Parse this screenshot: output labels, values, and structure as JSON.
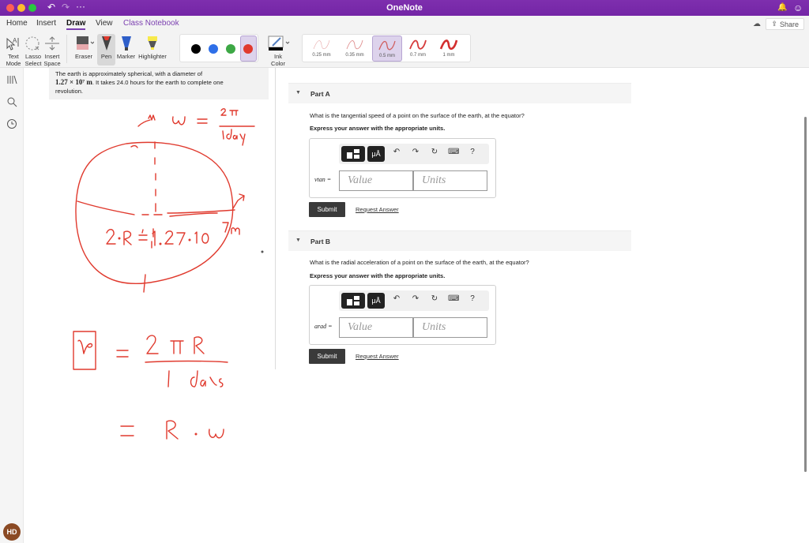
{
  "window": {
    "app_title": "OneNote",
    "titlebar_icons": [
      "undo-icon",
      "redo-icon",
      "more-icon",
      "bell-icon",
      "smiley-icon"
    ]
  },
  "ribbon_tabs": [
    {
      "label": "Home",
      "active": false
    },
    {
      "label": "Insert",
      "active": false
    },
    {
      "label": "Draw",
      "active": true
    },
    {
      "label": "View",
      "active": false
    },
    {
      "label": "Class Notebook",
      "active": false
    }
  ],
  "share": {
    "label": "Share"
  },
  "ribbon_tools": {
    "text_mode": "Text\nMode",
    "text_mode_l1": "Text",
    "text_mode_l2": "Mode",
    "lasso_l1": "Lasso",
    "lasso_l2": "Select",
    "insert_l1": "Insert",
    "insert_l2": "Space",
    "eraser": "Eraser",
    "pen": "Pen",
    "marker": "Marker",
    "highlighter": "Highlighter",
    "ink_color_l1": "Ink",
    "ink_color_l2": "Color"
  },
  "pen_colors": [
    {
      "name": "black",
      "hex": "#000000",
      "selected": false
    },
    {
      "name": "blue",
      "hex": "#2e6fe8",
      "selected": false
    },
    {
      "name": "green",
      "hex": "#3da845",
      "selected": false
    },
    {
      "name": "red",
      "hex": "#e03a2e",
      "selected": true
    }
  ],
  "pen_widths": [
    {
      "label": "0.25 mm",
      "selected": false
    },
    {
      "label": "0.35 mm",
      "selected": false
    },
    {
      "label": "0.5 mm",
      "selected": true
    },
    {
      "label": "0.7 mm",
      "selected": false
    },
    {
      "label": "1 mm",
      "selected": false
    }
  ],
  "sidebar": {
    "icons": [
      "notebooks-icon",
      "search-icon",
      "recent-icon"
    ],
    "avatar_initials": "HD"
  },
  "problem": {
    "line1": "The earth is approximately spherical, with a diameter of",
    "math": "1.27 × 10⁷ m",
    "line2_rest": ". It takes 24.0 hours for the earth to complete one",
    "line3": "revolution."
  },
  "parts": [
    {
      "title": "Part A",
      "question": "What is the tangential speed of a point on the surface of the earth, at the equator?",
      "instruction": "Express your answer with the appropriate units.",
      "variable_label": "vtan =",
      "value_placeholder": "Value",
      "units_placeholder": "Units",
      "submit_label": "Submit",
      "request_label": "Request Answer"
    },
    {
      "title": "Part B",
      "question": "What is the radial acceleration of a point on the surface of the earth, at the equator?",
      "instruction": "Express your answer with the appropriate units.",
      "variable_label": "arad =",
      "value_placeholder": "Value",
      "units_placeholder": "Units",
      "submit_label": "Submit",
      "request_label": "Request Answer"
    }
  ],
  "answer_toolbar": {
    "templates": "templates-icon",
    "units": "μÅ",
    "help": "?"
  },
  "handwriting": {
    "omega_eq": "ω = 2π / 1 day",
    "diameter_eq": "2·R = 1.27·10⁷ m",
    "v_eq": "v = 2πR / 1 day",
    "v_eq2": "= R · ω",
    "ink_color": "#e03a2e"
  }
}
